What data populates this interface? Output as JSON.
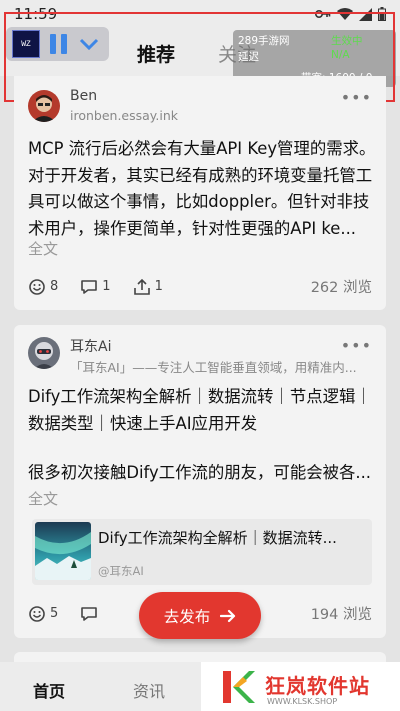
{
  "status": {
    "time": "11:59"
  },
  "tabs": {
    "recommend": "推荐",
    "follow": "关注"
  },
  "recorder": {
    "logo_text": "WZ"
  },
  "net_overlay": {
    "game": "289手游网",
    "state": "生效中",
    "latency_label": "延迟",
    "latency_value": "N/A",
    "bandwidth": "带宽: 1600 / 0 kbps"
  },
  "posts": [
    {
      "author": "Ben",
      "subtitle": "ironben.essay.ink",
      "text": "MCP 流行后必然会有大量API Key管理的需求。对于开发者，其实已经有成熟的环境变量托管工具可以做这个事情，比如doppler。但针对非技术用户，操作更简单，针对性更强的API ke...",
      "full_label": "全文",
      "likes": "8",
      "comments": "1",
      "shares": "1",
      "views": "262 浏览"
    },
    {
      "author": "耳东Ai",
      "subtitle": "「耳东AI」——专注人工智能垂直领域，用精准内...",
      "text_line1": "Dify工作流架构全解析｜数据流转｜节点逻辑｜数据类型｜快速上手AI应用开发",
      "text_line2": "很多初次接触Dify工作流的朋友，可能会被各...",
      "full_label": "全文",
      "link_title": "Dify工作流架构全解析｜数据流转...",
      "link_source": "@耳东AI",
      "likes": "5",
      "views": "194 浏览"
    }
  ],
  "fab": {
    "label": "去发布"
  },
  "bottom_nav": {
    "home": "首页",
    "news": "资讯"
  },
  "watermark": {
    "name": "狂岚软件站",
    "url": "WWW.KLSK.SHOP"
  },
  "colors": {
    "accent_red": "#e2372f",
    "status_green": "#5fdb4f",
    "control_blue": "#3d86e6"
  }
}
